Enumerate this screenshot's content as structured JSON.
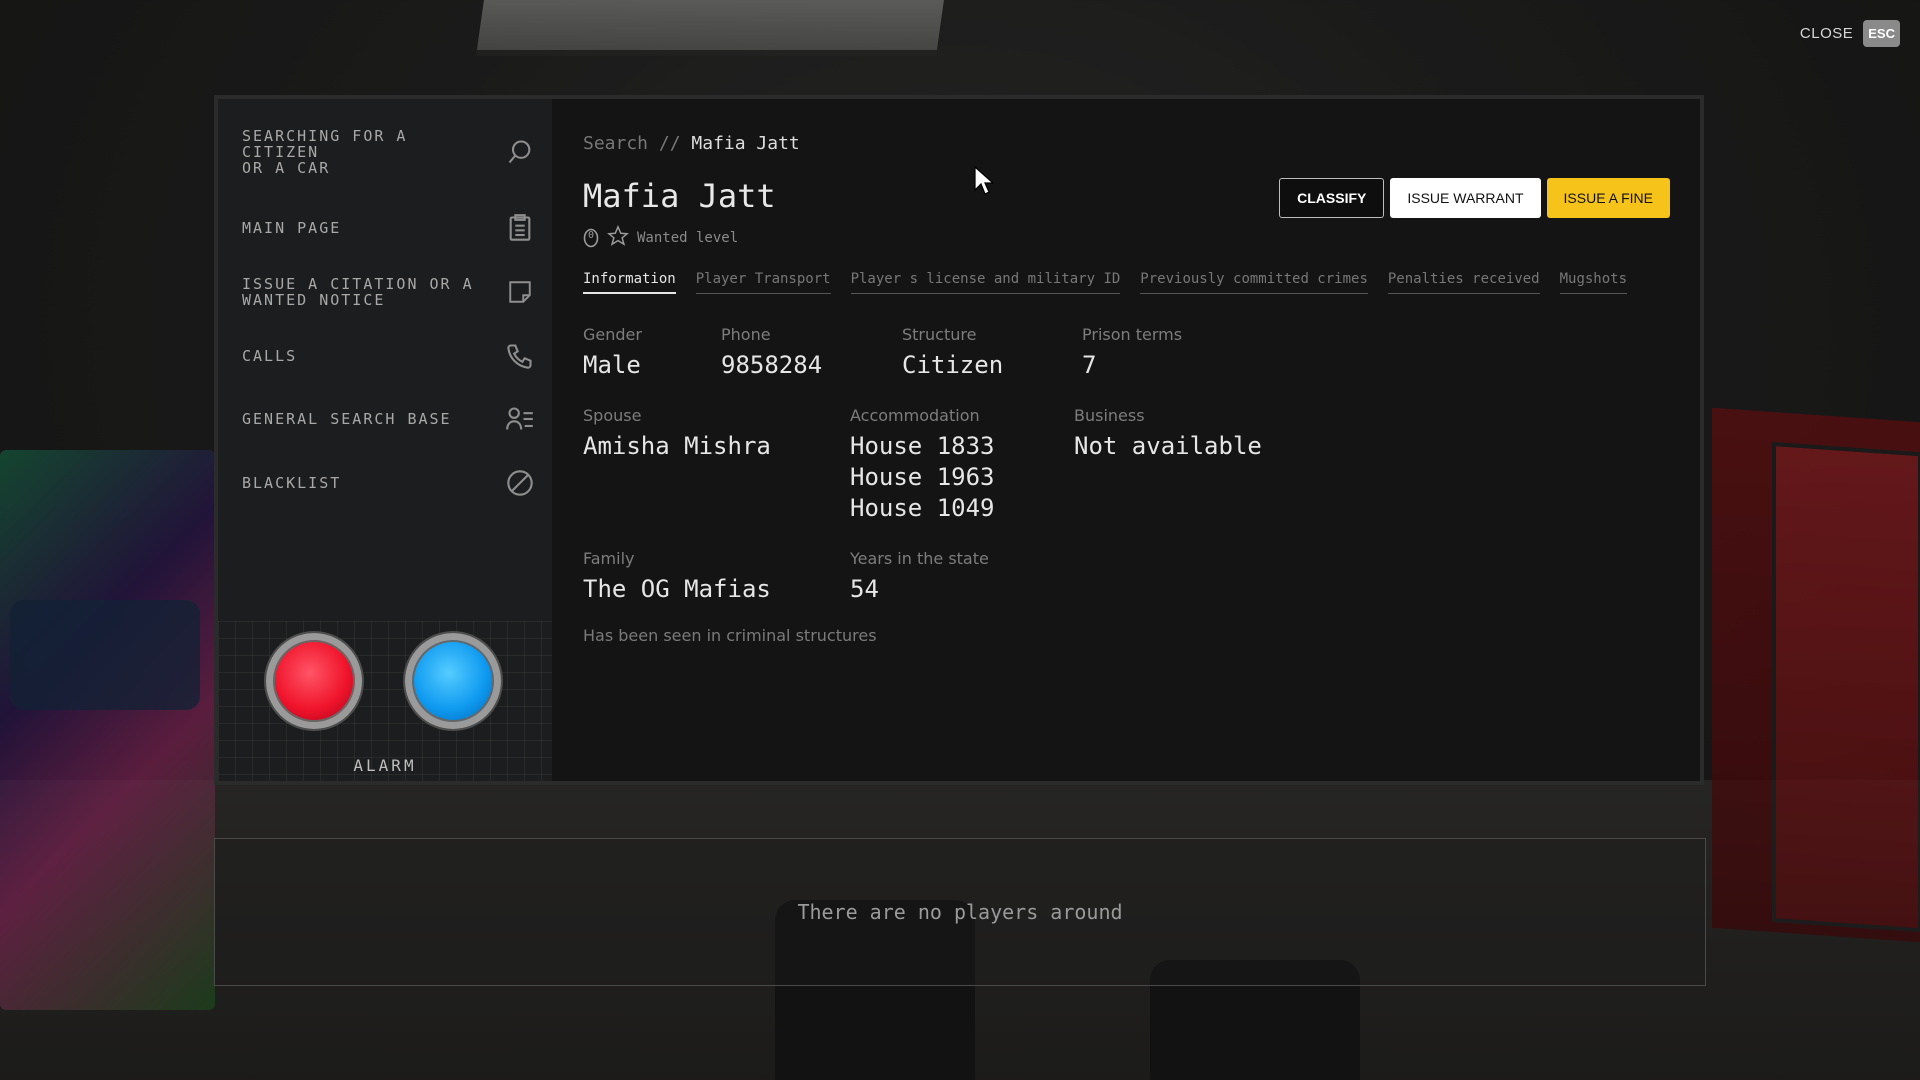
{
  "close": {
    "label": "CLOSE",
    "key": "ESC"
  },
  "sidebar": {
    "items": [
      {
        "label": "SEARCHING FOR A\nCITIZEN\nOR A CAR",
        "icon": "search-icon"
      },
      {
        "label": "MAIN PAGE",
        "icon": "clipboard-icon"
      },
      {
        "label": "ISSUE A CITATION OR A\nWANTED NOTICE",
        "icon": "note-icon"
      },
      {
        "label": "CALLS",
        "icon": "phone-icon"
      },
      {
        "label": "GENERAL SEARCH BASE",
        "icon": "user-list-icon"
      },
      {
        "label": "BLACKLIST",
        "icon": "ban-icon"
      }
    ],
    "alarm_label": "ALARM"
  },
  "breadcrumb": {
    "root": "Search //",
    "current": "Mafia Jatt"
  },
  "person": {
    "name": "Mafia Jatt",
    "wanted_label": "Wanted level",
    "wanted_value": "0"
  },
  "actions": {
    "classify": "CLASSIFY",
    "warrant": "ISSUE WARRANT",
    "fine": "ISSUE A FINE"
  },
  "tabs": [
    "Information",
    "Player Transport",
    "Player s license and military ID",
    "Previously committed crimes",
    "Penalties received",
    "Mugshots"
  ],
  "info": {
    "gender": {
      "label": "Gender",
      "value": "Male"
    },
    "phone": {
      "label": "Phone",
      "value": "9858284"
    },
    "structure": {
      "label": "Structure",
      "value": "Citizen"
    },
    "prison": {
      "label": "Prison terms",
      "value": "7"
    },
    "spouse": {
      "label": "Spouse",
      "value": "Amisha Mishra"
    },
    "accommodation": {
      "label": "Accommodation",
      "values": [
        "House 1833",
        "House 1963",
        "House 1049"
      ]
    },
    "business": {
      "label": "Business",
      "value": "Not available"
    },
    "family": {
      "label": "Family",
      "value": "The OG Mafias"
    },
    "years": {
      "label": "Years in the state",
      "value": "54"
    },
    "note": "Has been seen in criminal structures"
  },
  "players": {
    "empty_text": "There are no players around"
  },
  "colors": {
    "accent": "#f6c31a",
    "alarm_red": "#f0142b",
    "alarm_blue": "#0f9af0"
  }
}
